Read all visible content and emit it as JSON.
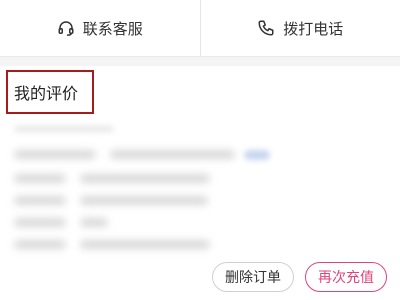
{
  "top_bar": {
    "contact_service": {
      "label": "联系客服",
      "icon": "headset-icon"
    },
    "call_phone": {
      "label": "拨打电话",
      "icon": "phone-icon"
    }
  },
  "review": {
    "title": "我的评价"
  },
  "actions": {
    "delete_order": "删除订单",
    "recharge_again": "再次充值"
  },
  "colors": {
    "highlight_border": "#a51c1c",
    "accent": "#e0457b"
  }
}
